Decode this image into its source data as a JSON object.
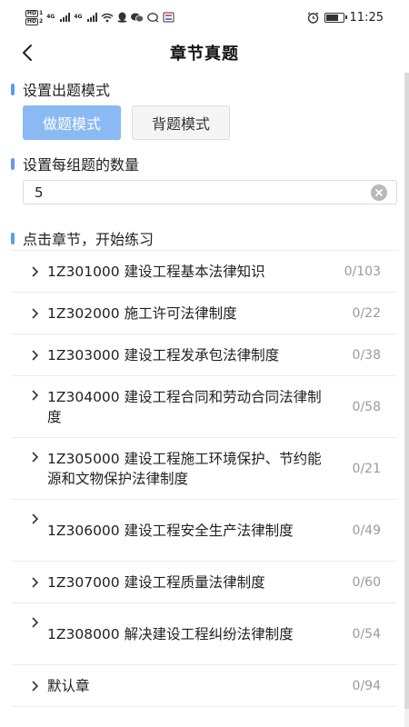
{
  "status_bar": {
    "time": "11:25",
    "sim1_label": "HD",
    "sim2_label": "HD",
    "net1": "4G",
    "net2": "4G"
  },
  "header": {
    "title": "章节真题"
  },
  "mode_section": {
    "title": "设置出题模式",
    "active_mode": "做题模式",
    "other_mode": "背题模式"
  },
  "count_section": {
    "title": "设置每组题的数量",
    "value": "5"
  },
  "chapter_section": {
    "title": "点击章节，开始练习",
    "items": [
      {
        "name": "1Z301000 建设工程基本法律知识",
        "count": "0/103"
      },
      {
        "name": "1Z302000 施工许可法律制度",
        "count": "0/22"
      },
      {
        "name": "1Z303000 建设工程发承包法律制度",
        "count": "0/38"
      },
      {
        "name": "1Z304000 建设工程合同和劳动合同法律制度",
        "count": "0/58"
      },
      {
        "name": "1Z305000 建设工程施工环境保护、节约能源和文物保护法律制度",
        "count": "0/21"
      },
      {
        "name": "1Z306000 建设工程安全生产法律制度",
        "count": "0/49"
      },
      {
        "name": "1Z307000 建设工程质量法律制度",
        "count": "0/60"
      },
      {
        "name": "1Z308000 解决建设工程纠纷法律制度",
        "count": "0/54"
      },
      {
        "name": "默认章",
        "count": "0/94"
      }
    ]
  },
  "colors": {
    "accent": "#5f9cf0",
    "active_button": "#8ab9f4",
    "count_text": "#9a9a9a"
  }
}
